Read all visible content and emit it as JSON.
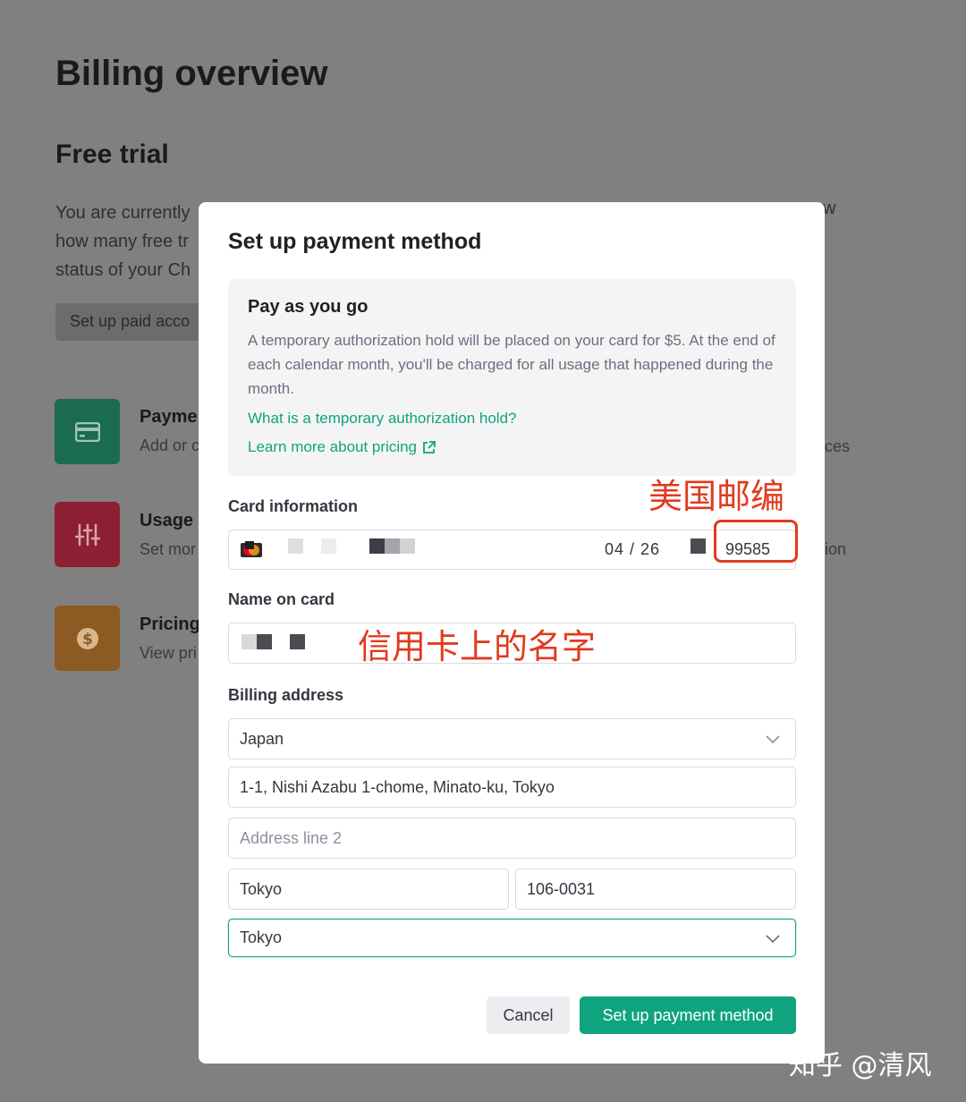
{
  "background": {
    "page_title": "Billing overview",
    "section_title": "Free trial",
    "paragraph": [
      "You are currently",
      "how many free tr",
      "status of your Ch"
    ],
    "paragraph_right": "w",
    "setup_button": "Set up paid acco",
    "items": [
      {
        "title": "Payme",
        "subtitle": "Add or c",
        "right": "ces",
        "icon": "credit-card-icon",
        "color": "#1b6b4f"
      },
      {
        "title": "Usage",
        "subtitle": "Set mor",
        "right": "ion",
        "icon": "sliders-icon",
        "color": "#8c2032"
      },
      {
        "title": "Pricing",
        "subtitle": "View pri",
        "right": "",
        "icon": "dollar-icon",
        "color": "#8c5a23"
      }
    ]
  },
  "modal": {
    "title": "Set up payment method",
    "info": {
      "title": "Pay as you go",
      "text": "A temporary authorization hold will be placed on your card for $5. At the end of each calendar month, you'll be charged for all usage that happened during the month.",
      "link1": "What is a temporary authorization hold?",
      "link2": "Learn more about pricing"
    },
    "card_label": "Card information",
    "card_expiry": "04 / 26",
    "card_zip": "99585",
    "name_label": "Name on card",
    "billing_label": "Billing address",
    "country": "Japan",
    "address1": "1-1, Nishi Azabu 1-chome, Minato-ku, Tokyo",
    "address2_placeholder": "Address line 2",
    "city": "Tokyo",
    "postal": "106-0031",
    "state": "Tokyo",
    "cancel": "Cancel",
    "submit": "Set up payment method"
  },
  "annotations": {
    "zip_note": "美国邮编",
    "name_note": "信用卡上的名字"
  },
  "watermark": "知乎 @清风",
  "colors": {
    "accent": "#10a37f",
    "annotation": "#e03a1e"
  }
}
